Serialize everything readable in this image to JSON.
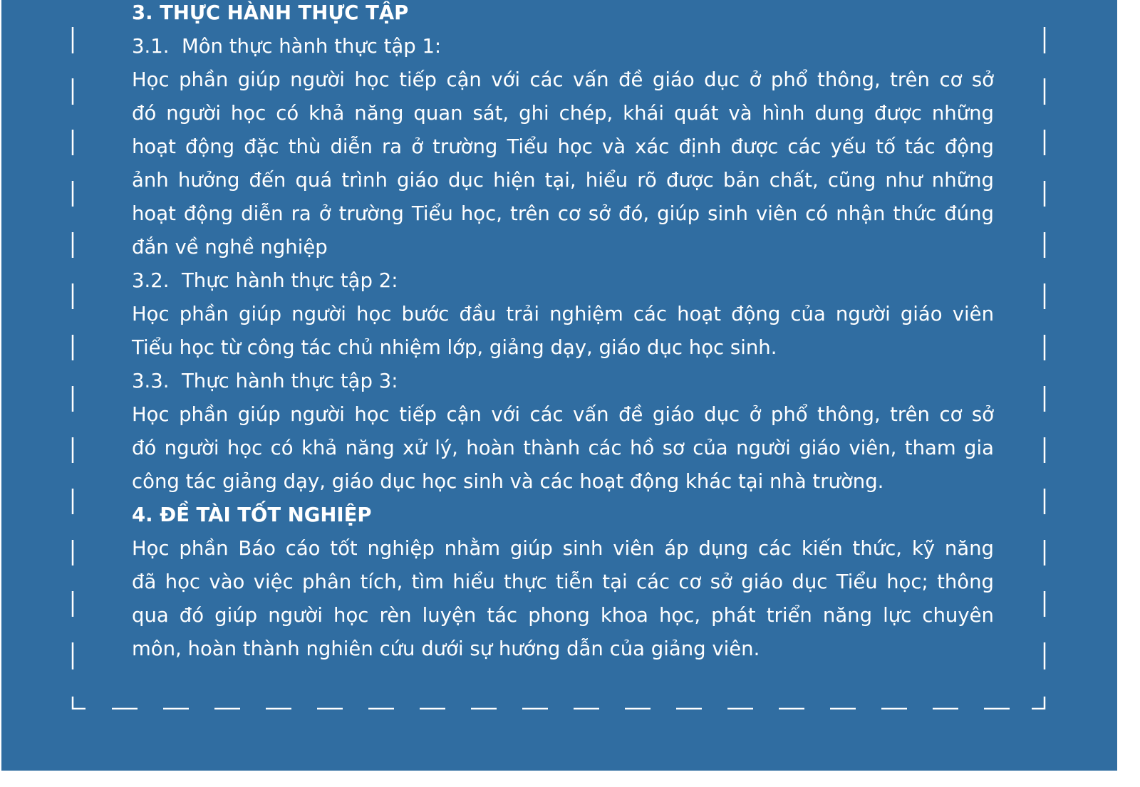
{
  "colors": {
    "background": "#306da1",
    "text": "#ffffff",
    "dash": "#ffffff"
  },
  "section3": {
    "heading": "3. THỰC HÀNH THỰC TẬP",
    "items": [
      {
        "number": "3.1.",
        "title": "Môn thực hành thực tập 1:",
        "lines": [
          "Học phần giúp người học tiếp cận với các vấn đề giáo dục ở phổ thông, trên cơ sở",
          "đó người học có khả năng quan sát, ghi chép, khái quát và hình dung được những",
          "hoạt động đặc thù diễn ra ở trường Tiểu học và xác định được các yếu tố tác động",
          "ảnh hưởng đến quá trình giáo dục hiện tại, hiểu rõ được bản chất, cũng như những",
          "hoạt động diễn ra ở trường Tiểu học, trên cơ sở đó, giúp sinh viên có nhận thức đúng",
          "đắn về nghề nghiệp"
        ]
      },
      {
        "number": "3.2.",
        "title": "Thực hành thực tập 2:",
        "lines": [
          "Học phần giúp người học bước đầu trải nghiệm các hoạt động của người giáo viên",
          "Tiểu học từ công tác chủ nhiệm lớp, giảng dạy, giáo dục học sinh."
        ]
      },
      {
        "number": "3.3.",
        "title": "Thực hành thực tập 3:",
        "lines": [
          "Học phần giúp người học tiếp cận với các vấn đề giáo dục ở phổ thông, trên cơ sở",
          "đó người học có khả năng xử lý, hoàn thành các hồ sơ của người giáo viên, tham gia",
          "công tác giảng dạy, giáo dục học sinh và các hoạt động khác tại nhà trường."
        ]
      }
    ]
  },
  "section4": {
    "heading": "4. ĐỀ TÀI TỐT NGHIỆP",
    "lines": [
      "Học phần Báo cáo tốt nghiệp nhằm giúp sinh viên áp dụng các kiến thức, kỹ năng",
      "đã học vào việc phân tích, tìm hiểu thực tiễn tại các cơ sở giáo dục Tiểu học; thông",
      "qua đó giúp người học rèn luyện tác phong khoa học, phát triển năng lực chuyên",
      "môn, hoàn thành nghiên cứu dưới sự hướng dẫn của giảng viên."
    ]
  }
}
